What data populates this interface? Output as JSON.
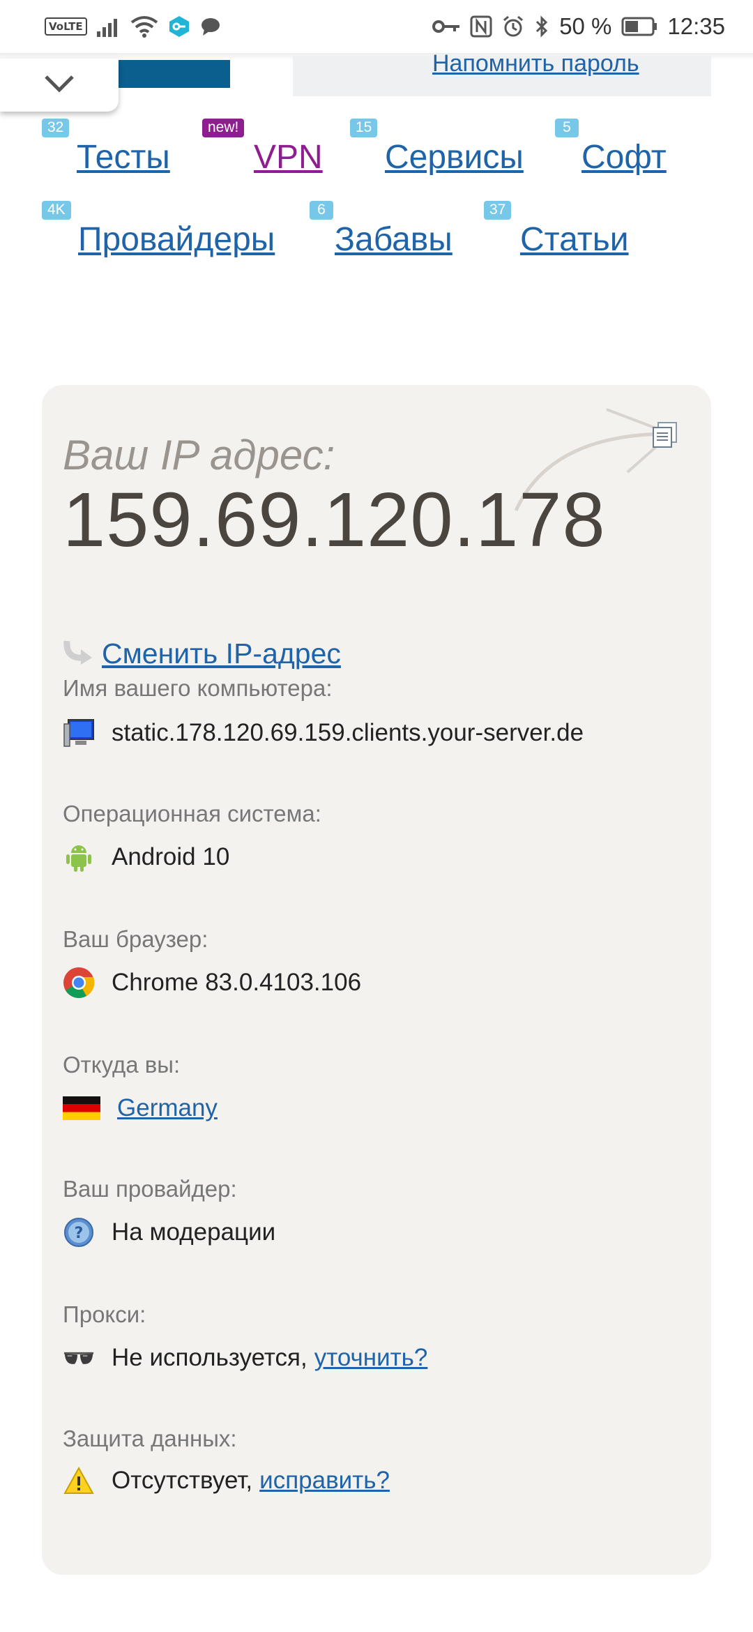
{
  "status_bar": {
    "volte": "VoLTE",
    "battery": "50 %",
    "time": "12:35"
  },
  "header": {
    "remind_link": "Напомнить пароль"
  },
  "nav": [
    {
      "badge": "32",
      "label": "Тесты"
    },
    {
      "badge": "new!",
      "label": "VPN"
    },
    {
      "badge": "15",
      "label": "Сервисы"
    },
    {
      "badge": "5",
      "label": "Софт"
    },
    {
      "badge": "4K",
      "label": "Провайдеры"
    },
    {
      "badge": "6",
      "label": "Забавы"
    },
    {
      "badge": "37",
      "label": "Статьи"
    }
  ],
  "ip_card": {
    "label": "Ваш IP адрес:",
    "ip": "159.69.120.178",
    "change_link": "Сменить IP-адрес",
    "hostname_label": "Имя вашего компьютера:",
    "hostname": "static.178.120.69.159.clients.your-server.de",
    "os_label": "Операционная система:",
    "os": "Android 10",
    "browser_label": "Ваш браузер:",
    "browser": "Chrome 83.0.4103.106",
    "location_label": "Откуда вы:",
    "country": "Germany",
    "isp_label": "Ваш провайдер:",
    "isp": "На модерации",
    "proxy_label": "Прокси:",
    "proxy": "Не используется,",
    "proxy_link": "уточнить?",
    "protection_label": "Защита данных:",
    "protection": "Отсутствует,",
    "protection_link": "исправить?"
  },
  "colors": {
    "link": "#1f63a8",
    "vpn": "#8e1d8f",
    "badge": "#77c7e8",
    "card_bg": "#f4f2ef"
  }
}
